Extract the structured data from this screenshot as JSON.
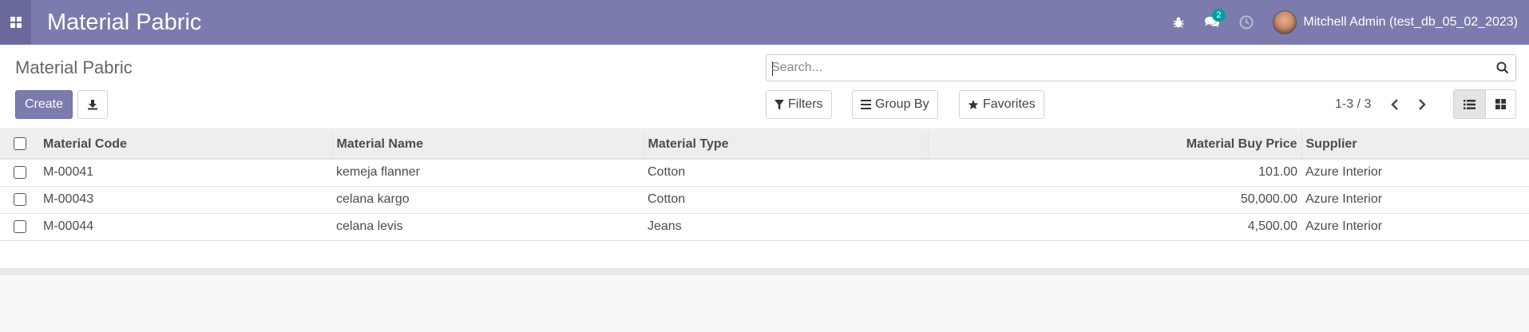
{
  "navbar": {
    "app_title": "Material Pabric",
    "chat_badge": "2",
    "user_name": "Mitchell Admin (test_db_05_02_2023)"
  },
  "control_panel": {
    "breadcrumb": "Material Pabric",
    "create_label": "Create",
    "search_placeholder": "Search...",
    "filters_label": "Filters",
    "group_by_label": "Group By",
    "favorites_label": "Favorites",
    "pager": "1-3 / 3"
  },
  "table": {
    "columns": [
      "Material Code",
      "Material Name",
      "Material Type",
      "Material Buy Price",
      "Supplier"
    ],
    "rows": [
      {
        "code": "M-00041",
        "name": "kemeja flanner",
        "type": "Cotton",
        "price": "101.00",
        "supplier": "Azure Interior"
      },
      {
        "code": "M-00043",
        "name": "celana kargo",
        "type": "Cotton",
        "price": "50,000.00",
        "supplier": "Azure Interior"
      },
      {
        "code": "M-00044",
        "name": "celana levis",
        "type": "Jeans",
        "price": "4,500.00",
        "supplier": "Azure Interior"
      }
    ]
  },
  "colors": {
    "navbar": "#7c7bad",
    "apps_button": "#6a6a9c",
    "badge": "#00a09d"
  }
}
